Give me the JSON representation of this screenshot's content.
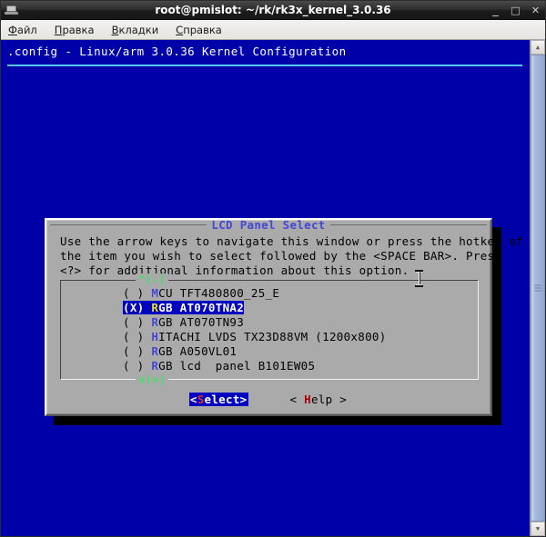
{
  "window": {
    "title": "root@pmislot: ~/rk/rk3x_kernel_3.0.36",
    "icon": "terminal-icon",
    "controls": {
      "minimize": "_",
      "maximize": "□",
      "close": "✕"
    }
  },
  "menubar": {
    "items": [
      {
        "mnemonic": "Ф",
        "rest": "айл"
      },
      {
        "mnemonic": "П",
        "rest": "равка"
      },
      {
        "mnemonic": "В",
        "rest": "кладки"
      },
      {
        "mnemonic": "С",
        "rest": "правка"
      }
    ]
  },
  "terminal": {
    "background": "#0000a8",
    "header": ".config - Linux/arm 3.0.36 Kernel Configuration"
  },
  "scrollbar": {
    "up_arrow": "▲",
    "down_arrow": "▼"
  },
  "dialog": {
    "title": "LCD Panel Select",
    "help_text": "Use the arrow keys to navigate this window or press the hotkey of\nthe item you wish to select followed by the <SPACE BAR>. Press\n<?> for additional information about this option.",
    "list": {
      "scroll_up_marker": "^(-)",
      "scroll_down_marker": "v(+)",
      "items": [
        {
          "mark": "( )",
          "hotkey": "M",
          "label": "CU TFT480800_25_E",
          "selected": false
        },
        {
          "mark": "(X)",
          "hotkey": "R",
          "label": "GB AT070TNA2",
          "selected": true
        },
        {
          "mark": "( )",
          "hotkey": "R",
          "label": "GB AT070TN93",
          "selected": false
        },
        {
          "mark": "( )",
          "hotkey": "H",
          "label": "ITACHI LVDS TX23D88VM (1200x800)",
          "selected": false
        },
        {
          "mark": "( )",
          "hotkey": "R",
          "label": "GB A050VL01",
          "selected": false
        },
        {
          "mark": "( )",
          "hotkey": "R",
          "label": "GB lcd  panel B101EW05",
          "selected": false
        }
      ]
    },
    "buttons": {
      "select": {
        "pre": "<",
        "hot": "S",
        "post": "elect>"
      },
      "help": {
        "pre": "< ",
        "hot": "H",
        "post": "elp >"
      }
    }
  },
  "colors": {
    "terminal_bg": "#0000a8",
    "dialog_bg": "#aaaaaa",
    "highlight_bg": "#0000c0",
    "hotkey_blue": "#4646d8",
    "hotkey_yellow": "#e8e800",
    "marker_green": "#44e06a",
    "rule_cyan": "#54c8f0",
    "help_hot_red": "#b00000"
  }
}
